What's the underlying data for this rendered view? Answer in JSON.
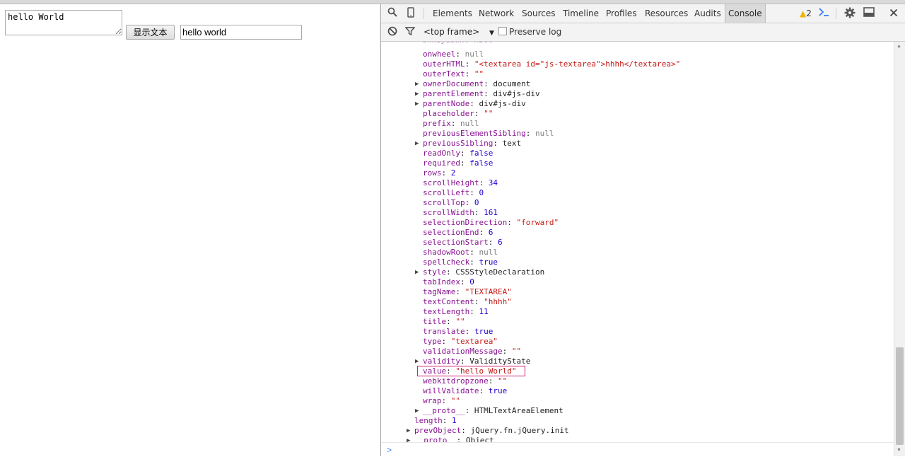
{
  "page": {
    "textarea_value": "hello World",
    "button_label": "显示文本",
    "input_value": "hello world"
  },
  "devtools": {
    "tabs": [
      "Elements",
      "Network",
      "Sources",
      "Timeline",
      "Profiles",
      "Resources",
      "Audits",
      "Console"
    ],
    "active_tab": "Console",
    "warning_count": "2",
    "frame_select": "<top frame>",
    "preserve_log_label": "Preserve log",
    "icons": [
      "search-icon",
      "device-icon",
      "warning-icon",
      "console-drawer-icon",
      "gear-icon",
      "dock-icon",
      "close-icon",
      "clear-icon",
      "filter-icon"
    ],
    "console_rows": [
      {
        "indent": 1,
        "expand": false,
        "key": "onwheel",
        "value": "null",
        "type": "null"
      },
      {
        "indent": 1,
        "expand": false,
        "key": "outerHTML",
        "value": "\"<textarea id=\"js-textarea\">hhhh</textarea>\"",
        "type": "string"
      },
      {
        "indent": 1,
        "expand": false,
        "key": "outerText",
        "value": "\"\"",
        "type": "string"
      },
      {
        "indent": 1,
        "expand": true,
        "key": "ownerDocument",
        "value": "document",
        "type": "object_name"
      },
      {
        "indent": 1,
        "expand": true,
        "key": "parentElement",
        "value": "div#js-div",
        "type": "object_name"
      },
      {
        "indent": 1,
        "expand": true,
        "key": "parentNode",
        "value": "div#js-div",
        "type": "object_name"
      },
      {
        "indent": 1,
        "expand": false,
        "key": "placeholder",
        "value": "\"\"",
        "type": "string"
      },
      {
        "indent": 1,
        "expand": false,
        "key": "prefix",
        "value": "null",
        "type": "null"
      },
      {
        "indent": 1,
        "expand": false,
        "key": "previousElementSibling",
        "value": "null",
        "type": "null"
      },
      {
        "indent": 1,
        "expand": true,
        "key": "previousSibling",
        "value": "text",
        "type": "object_name"
      },
      {
        "indent": 1,
        "expand": false,
        "key": "readOnly",
        "value": "false",
        "type": "number"
      },
      {
        "indent": 1,
        "expand": false,
        "key": "required",
        "value": "false",
        "type": "number"
      },
      {
        "indent": 1,
        "expand": false,
        "key": "rows",
        "value": "2",
        "type": "number"
      },
      {
        "indent": 1,
        "expand": false,
        "key": "scrollHeight",
        "value": "34",
        "type": "number"
      },
      {
        "indent": 1,
        "expand": false,
        "key": "scrollLeft",
        "value": "0",
        "type": "number"
      },
      {
        "indent": 1,
        "expand": false,
        "key": "scrollTop",
        "value": "0",
        "type": "number"
      },
      {
        "indent": 1,
        "expand": false,
        "key": "scrollWidth",
        "value": "161",
        "type": "number"
      },
      {
        "indent": 1,
        "expand": false,
        "key": "selectionDirection",
        "value": "\"forward\"",
        "type": "string"
      },
      {
        "indent": 1,
        "expand": false,
        "key": "selectionEnd",
        "value": "6",
        "type": "number"
      },
      {
        "indent": 1,
        "expand": false,
        "key": "selectionStart",
        "value": "6",
        "type": "number"
      },
      {
        "indent": 1,
        "expand": false,
        "key": "shadowRoot",
        "value": "null",
        "type": "null"
      },
      {
        "indent": 1,
        "expand": false,
        "key": "spellcheck",
        "value": "true",
        "type": "number"
      },
      {
        "indent": 1,
        "expand": true,
        "key": "style",
        "value": "CSSStyleDeclaration",
        "type": "object"
      },
      {
        "indent": 1,
        "expand": false,
        "key": "tabIndex",
        "value": "0",
        "type": "number"
      },
      {
        "indent": 1,
        "expand": false,
        "key": "tagName",
        "value": "\"TEXTAREA\"",
        "type": "string"
      },
      {
        "indent": 1,
        "expand": false,
        "key": "textContent",
        "value": "\"hhhh\"",
        "type": "string"
      },
      {
        "indent": 1,
        "expand": false,
        "key": "textLength",
        "value": "11",
        "type": "number"
      },
      {
        "indent": 1,
        "expand": false,
        "key": "title",
        "value": "\"\"",
        "type": "string"
      },
      {
        "indent": 1,
        "expand": false,
        "key": "translate",
        "value": "true",
        "type": "number"
      },
      {
        "indent": 1,
        "expand": false,
        "key": "type",
        "value": "\"textarea\"",
        "type": "string"
      },
      {
        "indent": 1,
        "expand": false,
        "key": "validationMessage",
        "value": "\"\"",
        "type": "string"
      },
      {
        "indent": 1,
        "expand": true,
        "key": "validity",
        "value": "ValidityState",
        "type": "object"
      },
      {
        "indent": 1,
        "expand": false,
        "key": "value",
        "value": "\"hello World\"",
        "type": "string",
        "highlight": true
      },
      {
        "indent": 1,
        "expand": false,
        "key": "webkitdropzone",
        "value": "\"\"",
        "type": "string"
      },
      {
        "indent": 1,
        "expand": false,
        "key": "willValidate",
        "value": "true",
        "type": "number"
      },
      {
        "indent": 1,
        "expand": false,
        "key": "wrap",
        "value": "\"\"",
        "type": "string"
      },
      {
        "indent": 1,
        "expand": true,
        "key": "__proto__",
        "value": "HTMLTextAreaElement",
        "type": "object"
      },
      {
        "indent": 0,
        "expand": false,
        "key": "length",
        "value": "1",
        "type": "number"
      },
      {
        "indent": 0,
        "expand": true,
        "key": "prevObject",
        "value": "jQuery.fn.jQuery.init",
        "type": "object"
      },
      {
        "indent": 0,
        "expand": true,
        "key": "__proto__",
        "value": "Object",
        "type": "object"
      }
    ],
    "prompt_symbol": ">"
  },
  "colors": {
    "key": "#881391",
    "string": "#c41a16",
    "number": "#1c00cf",
    "null": "#808080",
    "highlight_border": "#d3207a",
    "prompt": "#367cf1"
  }
}
